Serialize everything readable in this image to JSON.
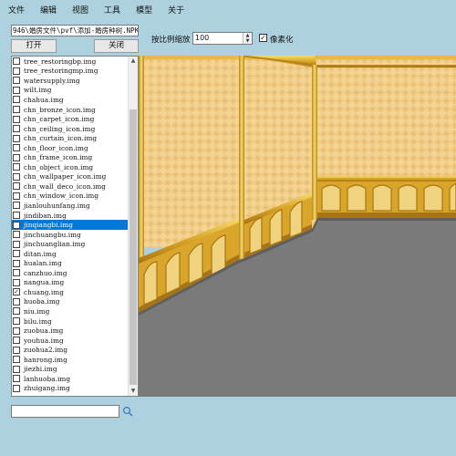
{
  "menu": [
    "文件",
    "编辑",
    "视图",
    "工具",
    "模型",
    "关于"
  ],
  "path_value": "946\\婚房文件\\pvf\\添加-婚房种树.NPK",
  "open_button": "打开",
  "close_button": "关闭",
  "files": [
    {
      "name": "tree_restoringbp.img",
      "checked": false
    },
    {
      "name": "tree_restoringmp.img",
      "checked": false
    },
    {
      "name": "watersupply.img",
      "checked": false
    },
    {
      "name": "wilt.img",
      "checked": false
    },
    {
      "name": "chahua.img",
      "checked": false
    },
    {
      "name": "chn_bronze_icon.img",
      "checked": false
    },
    {
      "name": "chn_carpet_icon.img",
      "checked": false
    },
    {
      "name": "chn_ceiling_icon.img",
      "checked": false
    },
    {
      "name": "chn_curtain_icon.img",
      "checked": false
    },
    {
      "name": "chn_floor_icon.img",
      "checked": false
    },
    {
      "name": "chn_frame_icon.img",
      "checked": false
    },
    {
      "name": "chn_object_icon.img",
      "checked": false
    },
    {
      "name": "chn_wallpaper_icon.img",
      "checked": false
    },
    {
      "name": "chn_wall_deco_icon.img",
      "checked": false
    },
    {
      "name": "chn_window_icon.img",
      "checked": false
    },
    {
      "name": "jianlouhunfang.img",
      "checked": false
    },
    {
      "name": "jindiban.img",
      "checked": false
    },
    {
      "name": "jinqiangbi.img",
      "checked": false,
      "selected": true
    },
    {
      "name": "jinchuangbu.img",
      "checked": false
    },
    {
      "name": "jinchuanglian.img",
      "checked": false
    },
    {
      "name": "ditan.img",
      "checked": false
    },
    {
      "name": "hualan.img",
      "checked": false
    },
    {
      "name": "canzhuo.img",
      "checked": false
    },
    {
      "name": "nangua.img",
      "checked": false
    },
    {
      "name": "chuang.img",
      "checked": true
    },
    {
      "name": "huoba.img",
      "checked": false
    },
    {
      "name": "niu.img",
      "checked": false
    },
    {
      "name": "bilu.img",
      "checked": false
    },
    {
      "name": "zuobua.img",
      "checked": false
    },
    {
      "name": "youhua.img",
      "checked": false
    },
    {
      "name": "zuohua2.img",
      "checked": false
    },
    {
      "name": "hanrong.img",
      "checked": false
    },
    {
      "name": "jiezhi.img",
      "checked": false
    },
    {
      "name": "lanhuoba.img",
      "checked": false
    },
    {
      "name": "zhuigang.img",
      "checked": false
    }
  ],
  "search": {
    "value": "",
    "icon": "search-icon"
  },
  "zoom": {
    "label": "按比例缩放",
    "value": "100"
  },
  "pixelate": {
    "label": "像素化",
    "checked": true
  },
  "colors": {
    "background": "#aed1df",
    "selection": "#0078d7",
    "wallpaper": "#f2d290",
    "wainscot": "#d8a828",
    "floor": "#777777"
  }
}
